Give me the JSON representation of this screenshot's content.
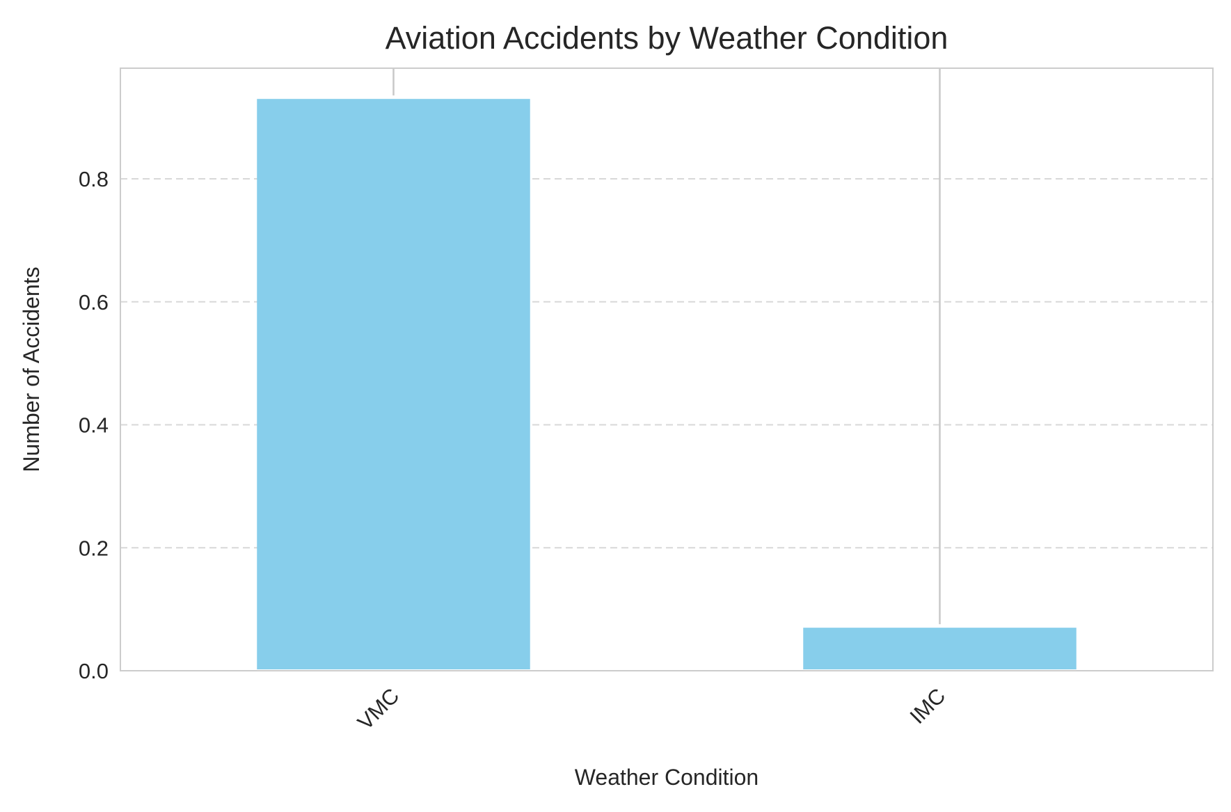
{
  "chart_data": {
    "type": "bar",
    "title": "Aviation Accidents by Weather Condition",
    "xlabel": "Weather Condition",
    "ylabel": "Number of Accidents",
    "categories": [
      "VMC",
      "IMC"
    ],
    "values": [
      0.93,
      0.07
    ],
    "error_bar_tops": [
      0.98,
      0.98
    ],
    "error_bar_bottoms": [
      0.93,
      0.07
    ],
    "ylim": [
      0,
      0.98
    ],
    "yticks": [
      0.0,
      0.2,
      0.4,
      0.6,
      0.8
    ],
    "ytick_labels": [
      "0.0",
      "0.2",
      "0.4",
      "0.6",
      "0.8"
    ],
    "grid": "y, dashed",
    "legend": "none",
    "bar_color": "#87CEEB"
  }
}
